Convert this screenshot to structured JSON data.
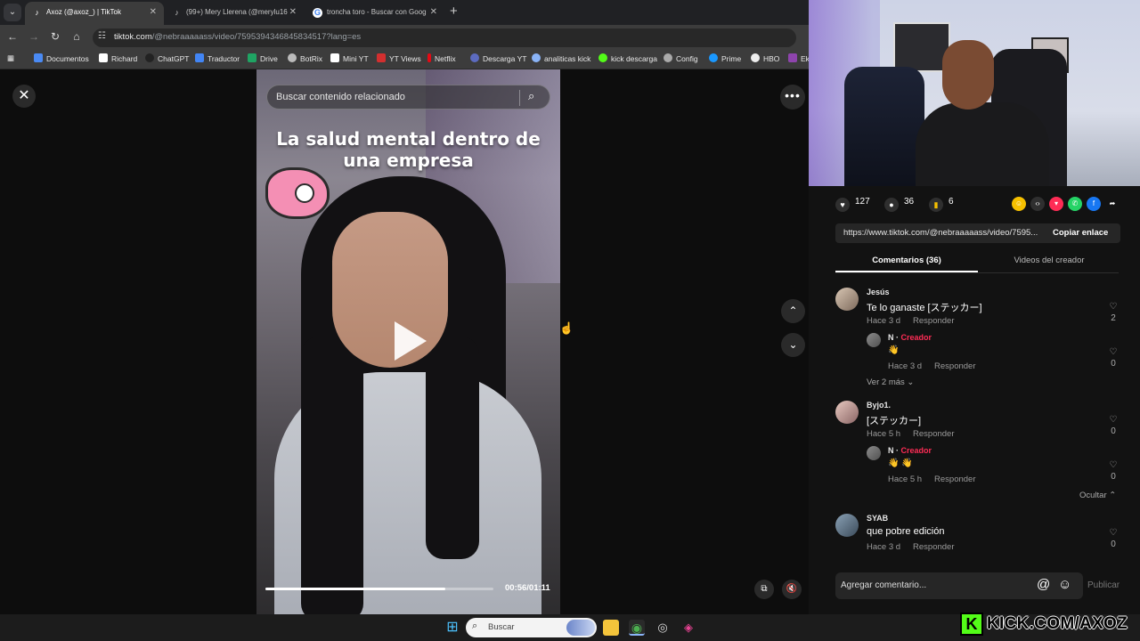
{
  "browser": {
    "tabs": [
      {
        "title": "Axoz (@axoz_) | TikTok",
        "active": true
      },
      {
        "title": "(99+) Mery Llerena (@merylu16",
        "active": false
      },
      {
        "title": "troncha toro - Buscar con Goog",
        "active": false
      }
    ],
    "url_host": "tiktok.com",
    "url_path": "/@nebraaaaass/video/7595394346845834517?lang=es",
    "bookmarks": [
      "Documentos",
      "Richard",
      "ChatGPT",
      "Traductor",
      "Drive",
      "BotRix",
      "Mini YT",
      "YT Views",
      "Netflix",
      "Descarga YT",
      "analiticas kick",
      "kick descarga",
      "Config",
      "Prime",
      "HBO",
      "Ek"
    ]
  },
  "player": {
    "search_placeholder": "Buscar contenido relacionado",
    "video_title": "La salud mental dentro de una empresa",
    "time": "00:56/01:11",
    "progress": 0.79
  },
  "panel": {
    "likes": "127",
    "comments": "36",
    "saves": "6",
    "share_link": "https://www.tiktok.com/@nebraaaaass/video/7595...",
    "copy_label": "Copiar enlace",
    "tab_comments": "Comentarios (36)",
    "tab_videos": "Videos del creador",
    "comment_list": [
      {
        "user": "Jesús",
        "text": "Te lo ganaste [ステッカー]",
        "time": "Hace 3 d",
        "reply": "Responder",
        "likes": "2"
      },
      {
        "user": "N",
        "creator": "Creador",
        "text": "👋",
        "time": "Hace 3 d",
        "reply": "Responder",
        "likes": "0"
      },
      {
        "user": "Byjo1.",
        "text": "[ステッカー]",
        "time": "Hace 5 h",
        "reply": "Responder",
        "likes": "0"
      },
      {
        "user": "N",
        "creator": "Creador",
        "text": "👋 👋",
        "time": "Hace 5 h",
        "reply": "Responder",
        "likes": "0"
      },
      {
        "user": "SYAB",
        "text": "que pobre edición",
        "time": "Hace 3 d",
        "reply": "Responder",
        "likes": "0"
      }
    ],
    "see_more": "Ver 2 más",
    "hide": "Ocultar",
    "add_comment_placeholder": "Agregar comentario...",
    "publish": "Publicar"
  },
  "taskbar": {
    "search_label": "Buscar"
  },
  "watermark": {
    "text": "KICK.COM/AXOZ",
    "letter": "K",
    "color": "#53fc18"
  }
}
